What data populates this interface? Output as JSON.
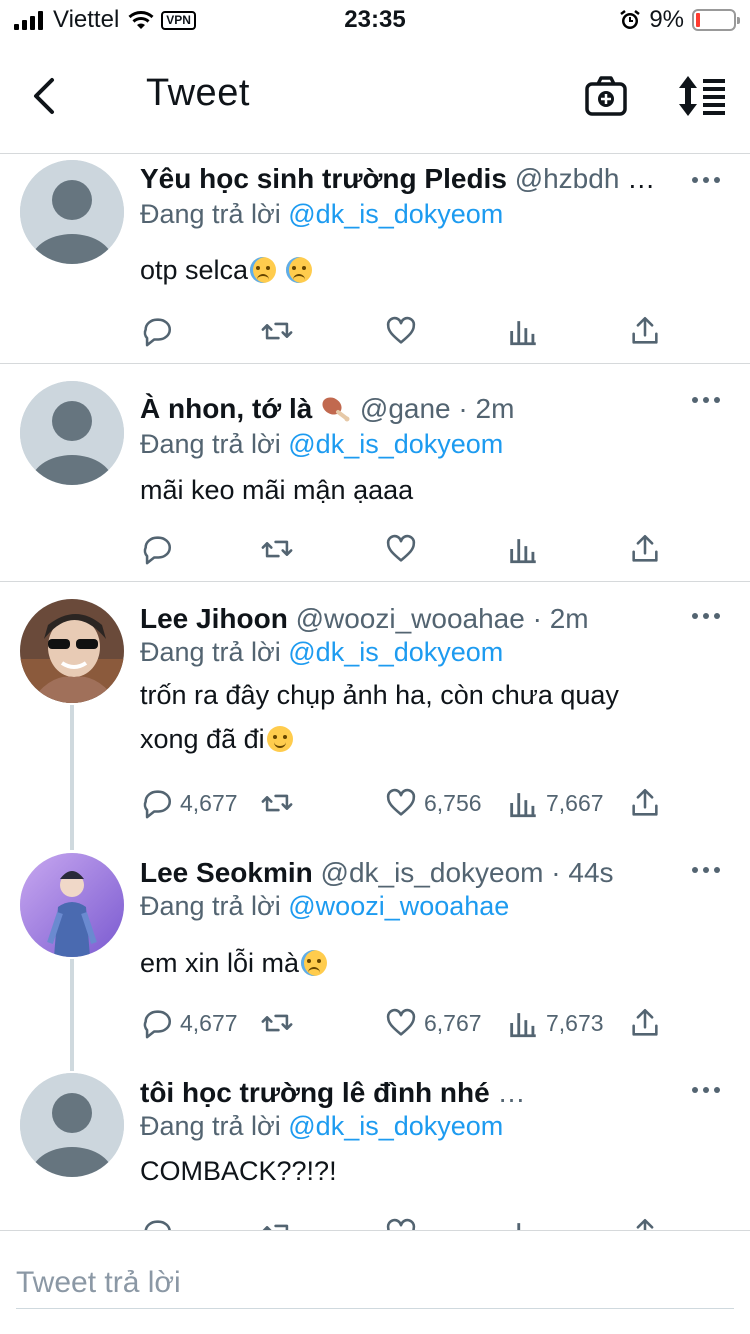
{
  "status_bar": {
    "carrier": "Viettel",
    "vpn": "VPN",
    "time": "23:35",
    "battery": "9%"
  },
  "header": {
    "title": "Tweet"
  },
  "colors": {
    "accent": "#1d9bf0",
    "text": "#0f1419",
    "muted": "#536471",
    "divider": "#d6d9db"
  },
  "tweets": [
    {
      "name": "Yêu học sinh trường Pledis",
      "handle": "@hzbdh · …",
      "reply_prefix": "Đang trả lời ",
      "reply_to": "@dk_is_dokyeom",
      "text": "otp selca",
      "emoji": "loudly-crying-face ×2",
      "stats": {
        "reply": "",
        "retweet": "",
        "like": "",
        "views": ""
      }
    },
    {
      "name": "À nhon, tớ là",
      "emoji_name": "poultry-leg",
      "handle": "@gane · 2m",
      "reply_prefix": "Đang trả lời ",
      "reply_to": "@dk_is_dokyeom",
      "text": "mãi keo mãi mận ạaaa",
      "stats": {
        "reply": "",
        "retweet": "",
        "like": "",
        "views": ""
      }
    },
    {
      "name": "Lee Jihoon",
      "handle": "@woozi_wooahae · 2m",
      "reply_prefix": "Đang trả lời ",
      "reply_to": "@dk_is_dokyeom",
      "text_line1": "trốn ra đây chụp ảnh ha, còn chưa quay",
      "text_line2": "xong đã đi",
      "emoji": "slightly-smiling-face",
      "stats": {
        "reply": "4,677",
        "retweet": "",
        "like": "6,756",
        "views": "7,667"
      }
    },
    {
      "name": "Lee Seokmin",
      "handle": "@dk_is_dokyeom · 44s",
      "reply_prefix": "Đang trả lời ",
      "reply_to": "@woozi_wooahae",
      "text": "em xin lỗi mà",
      "emoji": "crying-face",
      "stats": {
        "reply": "4,677",
        "retweet": "",
        "like": "6,767",
        "views": "7,673"
      }
    },
    {
      "name": "tôi học trường lê đình nhé",
      "handle": "…",
      "reply_prefix": "Đang trả lời ",
      "reply_to": "@dk_is_dokyeom",
      "text": "COMBACK??!?!"
    }
  ],
  "reply_bar": {
    "placeholder": "Tweet trả lời"
  }
}
